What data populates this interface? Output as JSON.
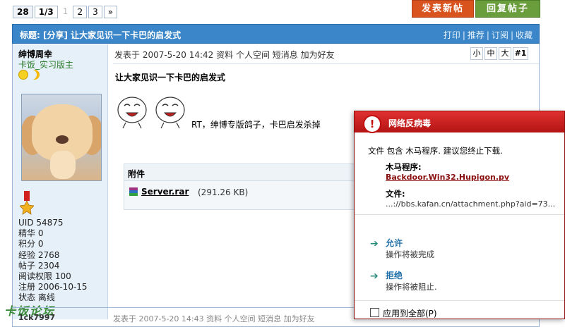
{
  "pager": {
    "total": "28",
    "page_of": "1/3",
    "current": "1",
    "pages": [
      "2",
      "3"
    ],
    "next": "»"
  },
  "buttons": {
    "post": "发表新帖",
    "reply": "回复帖子"
  },
  "thread": {
    "title": "标题: [分享] 让大家见识一下卡巴的启发式",
    "actions": [
      "打印",
      "推荐",
      "订阅",
      "收藏"
    ]
  },
  "user": {
    "name": "绅博周幸",
    "role": "卡饭_实习版主",
    "stats": [
      "UID 54875",
      "精华 0",
      "积分 0",
      "经验 2768",
      "帖子 2304",
      "阅读权限 100",
      "注册 2006-10-15",
      "状态 离线"
    ]
  },
  "post": {
    "info": "发表于 2007-5-20 14:42 资料 个人空间 短消息 加为好友",
    "font_sizes": [
      "小",
      "中",
      "大"
    ],
    "floor": "#1",
    "title": "让大家见识一下卡巴的启发式",
    "body": "RT，绅博专版鸽子，卡巴启发杀掉",
    "attachment": {
      "heading": "附件",
      "file": "Server.rar",
      "size": "(291.26 KB)"
    }
  },
  "watermark": "卡饭论坛",
  "next_post": {
    "user": "1ck7997",
    "info": "发表于 2007-5-20 14:43 资料 个人空间 短消息 加为好友"
  },
  "popup": {
    "title": "网络反病毒",
    "message": "文件 包含 木马程序. 建议您终止下载.",
    "trojan_label": "木马程序:",
    "trojan_name": "Backdoor.Win32.Hupigon.pv",
    "file_label": "文件:",
    "file_path": "...://bbs.kafan.cn/attachment.php?aid=73...",
    "allow": "允许",
    "allow_sub": "操作将被完成",
    "deny": "拒绝",
    "deny_sub": "操作将被阻止.",
    "apply_all": "应用到全部(P)",
    "icon": "!"
  },
  "colors": {
    "titlebar": "#3a86c8",
    "sidebar": "#e6f0f8",
    "post_btn": "#d9531e",
    "reply_btn": "#6a9d3c",
    "alert": "#c01010"
  }
}
